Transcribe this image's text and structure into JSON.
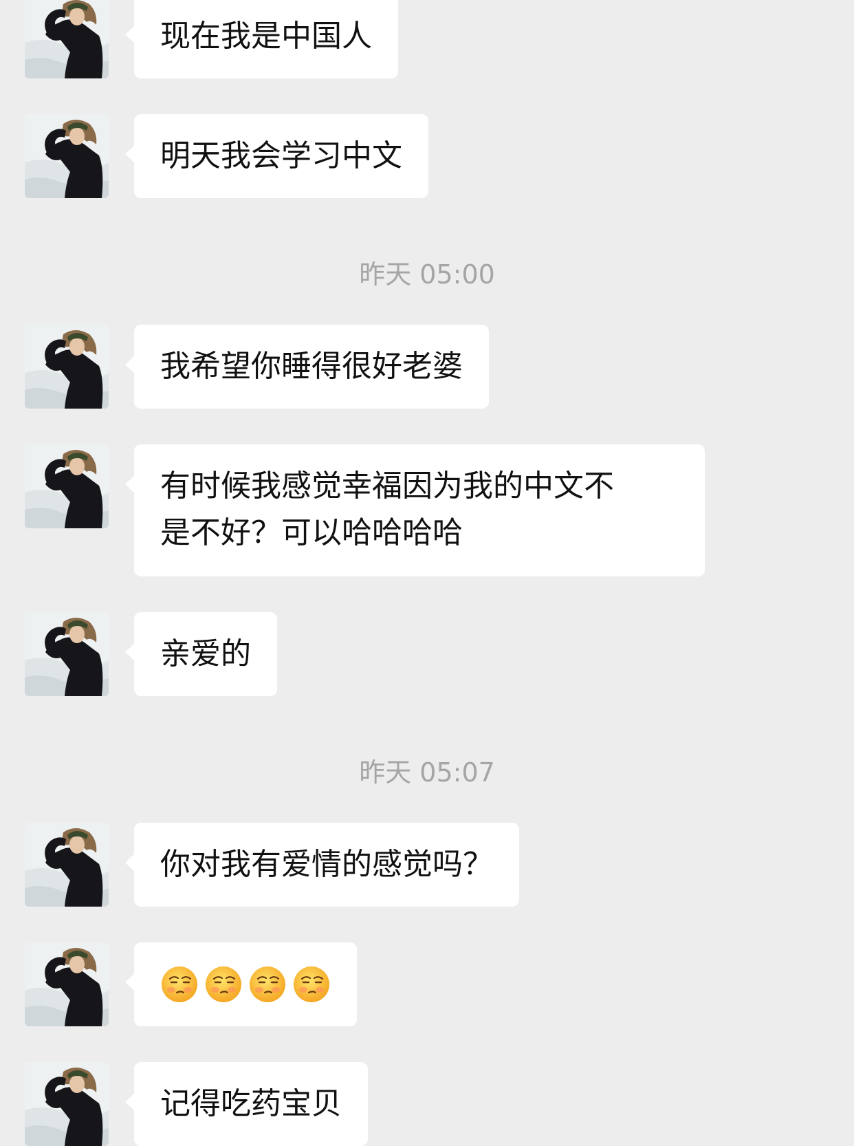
{
  "colors": {
    "background": "#ededed",
    "bubble": "#ffffff",
    "timestamp": "#a5a5a5",
    "text": "#111111"
  },
  "messages": [
    {
      "text": "现在我是中国人"
    },
    {
      "text": "明天我会学习中文"
    },
    {
      "text": "我希望你睡得很好老婆"
    },
    {
      "text": "有时候我感觉幸福因为我的中文不\n是不好？可以哈哈哈哈"
    },
    {
      "text": "亲爱的"
    },
    {
      "text": "你对我有爱情的感觉吗？"
    },
    {
      "emoji": "smirk-face-emoji",
      "count": 4
    },
    {
      "text": "记得吃药宝贝"
    }
  ],
  "timestamps": [
    {
      "text": "昨天 05:00"
    },
    {
      "text": "昨天 05:07"
    }
  ]
}
